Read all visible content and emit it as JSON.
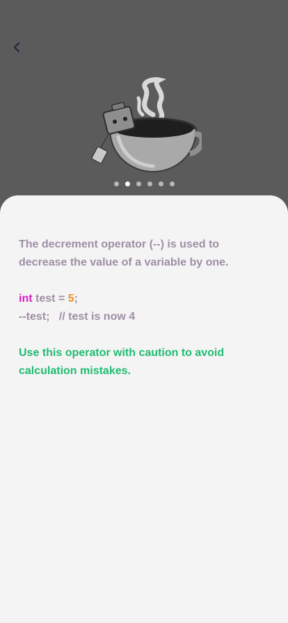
{
  "header": {
    "back_icon": "chevron-left-icon",
    "illustration": "tea-cup-robot-illustration",
    "accent_color": "#3a2a4a"
  },
  "pager": {
    "count": 6,
    "active_index": 1
  },
  "lesson": {
    "description": "The decrement operator (--) is used to decrease the value of a variable by one.",
    "code": {
      "line1": {
        "keyword": "int",
        "before_value": " test = ",
        "value": "5",
        "end": ";"
      },
      "line2": "--test;   // test is now 4"
    },
    "tip": "Use this operator with caution to avoid calculation mistakes."
  },
  "colors": {
    "background_top": "#5b5b5b",
    "sheet": "#f4f4f4",
    "text_muted": "#9e8ea5",
    "keyword": "#d81bbf",
    "number": "#f5901d",
    "tip": "#1ebc70"
  }
}
